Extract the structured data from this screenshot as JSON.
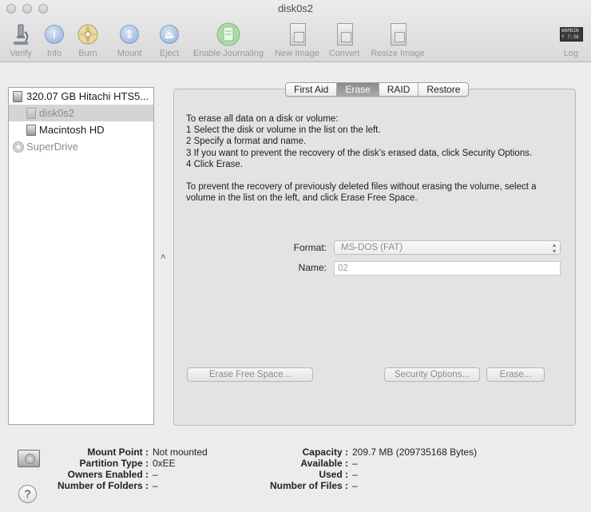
{
  "window": {
    "title": "disk0s2"
  },
  "toolbar": {
    "verify": "Verify",
    "info": "Info",
    "burn": "Burn",
    "mount": "Mount",
    "eject": "Eject",
    "enable_journaling": "Enable Journaling",
    "new_image": "New Image",
    "convert": "Convert",
    "resize_image": "Resize Image",
    "log": "Log",
    "log_icon_text": "WARNIN\nY 7:36"
  },
  "sidebar": {
    "items": [
      {
        "label": "320.07 GB Hitachi HTS5...",
        "icon": "hard-drive-icon"
      },
      {
        "label": "disk0s2",
        "icon": "volume-icon",
        "selected": true
      },
      {
        "label": "Macintosh HD",
        "icon": "volume-icon"
      },
      {
        "label": "SuperDrive",
        "icon": "optical-disc-icon"
      }
    ]
  },
  "tabs": [
    "First Aid",
    "Erase",
    "RAID",
    "Restore"
  ],
  "active_tab": "Erase",
  "erase": {
    "instructions": [
      "To erase all data on a disk or volume:",
      "1 Select the disk or volume in the list on the left.",
      "2 Specify a format and name.",
      "3 If you want to prevent the recovery of the disk’s erased data, click Security Options.",
      "4 Click Erase."
    ],
    "free_space_note_1": "To prevent the recovery of previously deleted files without erasing the volume, select a",
    "free_space_note_2": "volume in the list on the left, and click Erase Free Space.",
    "format_label": "Format:",
    "format_value": "MS-DOS (FAT)",
    "name_label": "Name:",
    "name_value": "02",
    "erase_free_space_button": "Erase Free Space...",
    "security_options_button": "Security Options...",
    "erase_button": "Erase..."
  },
  "info": {
    "mount_point_label": "Mount Point :",
    "mount_point_value": "Not mounted",
    "partition_type_label": "Partition Type :",
    "partition_type_value": "0xEE",
    "owners_enabled_label": "Owners Enabled :",
    "owners_enabled_value": "–",
    "number_of_folders_label": "Number of Folders :",
    "number_of_folders_value": "–",
    "capacity_label": "Capacity :",
    "capacity_value": "209.7 MB (209735168 Bytes)",
    "available_label": "Available :",
    "available_value": "–",
    "used_label": "Used :",
    "used_value": "–",
    "number_of_files_label": "Number of Files :",
    "number_of_files_value": "–"
  },
  "help_label": "?"
}
